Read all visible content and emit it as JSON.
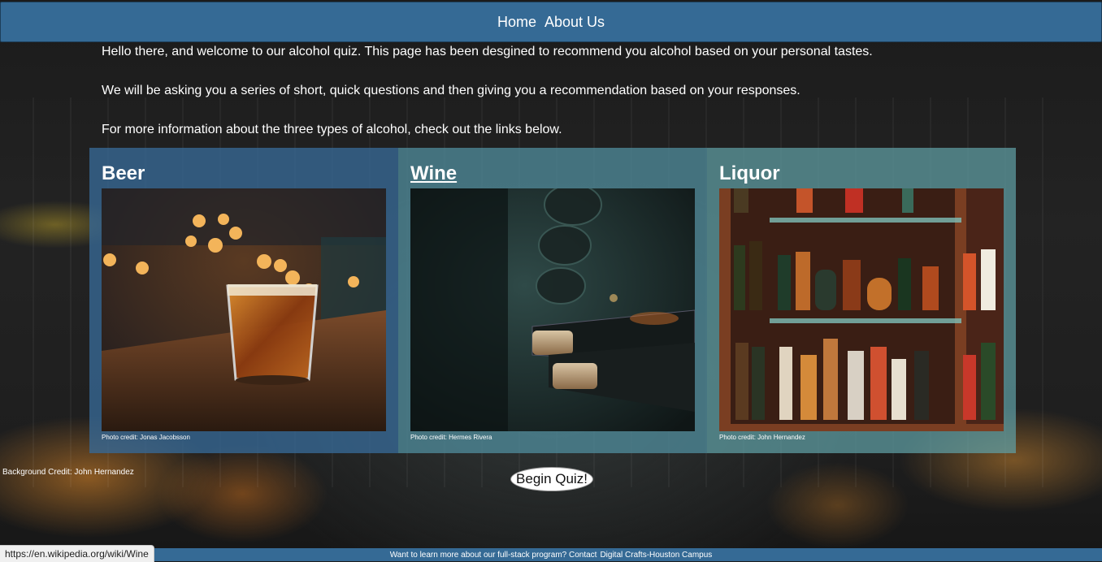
{
  "nav": {
    "home": "Home",
    "about": "About Us"
  },
  "intro": {
    "p1": "Hello there, and welcome to our alcohol quiz. This page has been desgined to recommend you alcohol based on your personal tastes.",
    "p2": "We will be asking you a series of short, quick questions and then giving you a recommendation based on your responses.",
    "p3": "For more information about the three types of alcohol, check out the links below."
  },
  "cards": [
    {
      "title": "Beer",
      "credit": "Photo credit: Jonas Jacobsson"
    },
    {
      "title": "Wine",
      "credit": "Photo credit: Hermes Rivera"
    },
    {
      "title": "Liquor",
      "credit": "Photo credit: John Hernandez"
    }
  ],
  "background_credit": "Background Credit: John Hernandez",
  "quiz_button": "Begin Quiz!",
  "footer": {
    "text": "Want to learn more about our full-stack program? Contact",
    "link": "Digital Crafts-Houston Campus"
  },
  "status_url": "https://en.wikipedia.org/wiki/Wine",
  "colors": {
    "nav_bg": "#356a95",
    "footer_bg": "#356a95"
  }
}
